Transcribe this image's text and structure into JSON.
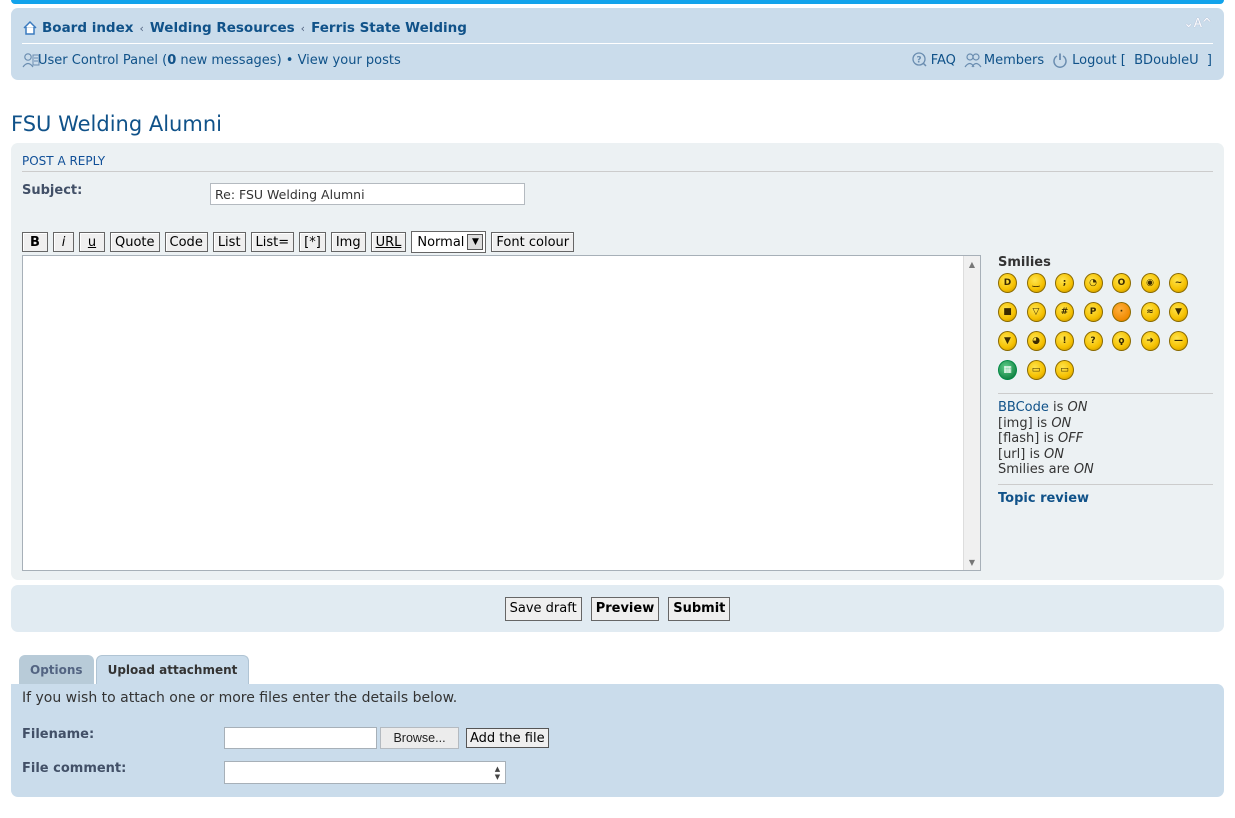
{
  "header": {
    "breadcrumbs": [
      "Board index",
      "Welding Resources",
      "Ferris State Welding"
    ],
    "breadcrumb_separator": "‹",
    "font_size_control": "⌄A^",
    "ucp_label": "User Control Panel",
    "ucp_open": " (",
    "new_messages_count": "0",
    "new_messages_text": " new messages)",
    "bullet": " • ",
    "view_posts": "View your posts",
    "faq": "FAQ",
    "members": "Members",
    "logout": "Logout",
    "username_bracket_open": "[ ",
    "username": "BDoubleU",
    "username_bracket_close": " ]"
  },
  "page": {
    "title": "FSU Welding Alumni"
  },
  "post_form": {
    "heading": "POST A REPLY",
    "subject_label": "Subject:",
    "subject_value": "Re: FSU Welding Alumni",
    "toolbar": {
      "bold": "B",
      "italic": "i",
      "underline": "u",
      "quote": "Quote",
      "code": "Code",
      "list": "List",
      "list_ordered": "List=",
      "list_item": "[*]",
      "img": "Img",
      "url": "URL",
      "font_size_selected": "Normal",
      "font_colour": "Font colour"
    },
    "message_value": ""
  },
  "smilies": {
    "title": "Smilies",
    "items": [
      {
        "name": "very-happy",
        "face": "D"
      },
      {
        "name": "smile",
        "face": "‿"
      },
      {
        "name": "wink",
        "face": ";"
      },
      {
        "name": "rolling-eyes",
        "face": "◔"
      },
      {
        "name": "surprised",
        "face": "O"
      },
      {
        "name": "eek",
        "face": "◉"
      },
      {
        "name": "confused",
        "face": "~"
      },
      {
        "name": "cool",
        "face": "■"
      },
      {
        "name": "laughing",
        "face": "▽"
      },
      {
        "name": "mad",
        "face": "#"
      },
      {
        "name": "razz",
        "face": "P"
      },
      {
        "name": "embarrassed",
        "face": "·",
        "variant": "orange"
      },
      {
        "name": "crying",
        "face": "≈"
      },
      {
        "name": "evil",
        "face": "▼"
      },
      {
        "name": "twisted-evil",
        "face": "▼"
      },
      {
        "name": "rolling-eyes-2",
        "face": "◕"
      },
      {
        "name": "exclaim",
        "face": "!"
      },
      {
        "name": "question",
        "face": "?"
      },
      {
        "name": "idea",
        "face": "ϙ"
      },
      {
        "name": "arrow",
        "face": "➜"
      },
      {
        "name": "neutral",
        "face": "—"
      },
      {
        "name": "mr-green",
        "face": "▦",
        "variant": "green"
      },
      {
        "name": "geek",
        "face": "▭"
      },
      {
        "name": "ugeek",
        "face": "▭"
      }
    ]
  },
  "post_status": {
    "bbcode_link": "BBCode",
    "bbcode_is": " is ",
    "bbcode_state": "ON",
    "img_label": "[img] is ",
    "img_state": "ON",
    "flash_label": "[flash] is ",
    "flash_state": "OFF",
    "url_label": "[url] is ",
    "url_state": "ON",
    "smilies_label": "Smilies are ",
    "smilies_state": "ON",
    "topic_review": "Topic review"
  },
  "submit_buttons": {
    "save_draft": "Save draft",
    "preview": "Preview",
    "submit": "Submit"
  },
  "tabs": [
    {
      "label": "Options",
      "active": false
    },
    {
      "label": "Upload attachment",
      "active": true
    }
  ],
  "attachment": {
    "intro": "If you wish to attach one or more files enter the details below.",
    "filename_label": "Filename:",
    "filename_value": "",
    "browse": "Browse...",
    "add_file": "Add the file",
    "comment_label": "File comment:",
    "comment_value": ""
  },
  "colors": {
    "link": "#105289",
    "navbar_bg": "#cadceb",
    "panel_bg": "#ecf1f3",
    "accent_stripe": "#12a3eb"
  }
}
